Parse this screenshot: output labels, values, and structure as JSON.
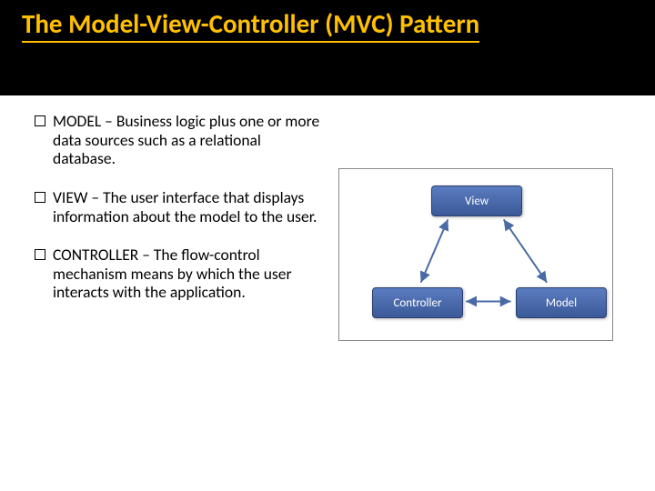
{
  "title": "The Model-View-Controller (MVC) Pattern",
  "bullets": [
    {
      "text": "MODEL – Business logic plus one or more data sources such as a relational database."
    },
    {
      "text": "VIEW – The user interface that displays information about the model to the user."
    },
    {
      "text": "CONTROLLER – The flow-control mechanism means by which the user interacts with the application."
    }
  ],
  "diagram": {
    "view": "View",
    "controller": "Controller",
    "model": "Model"
  }
}
